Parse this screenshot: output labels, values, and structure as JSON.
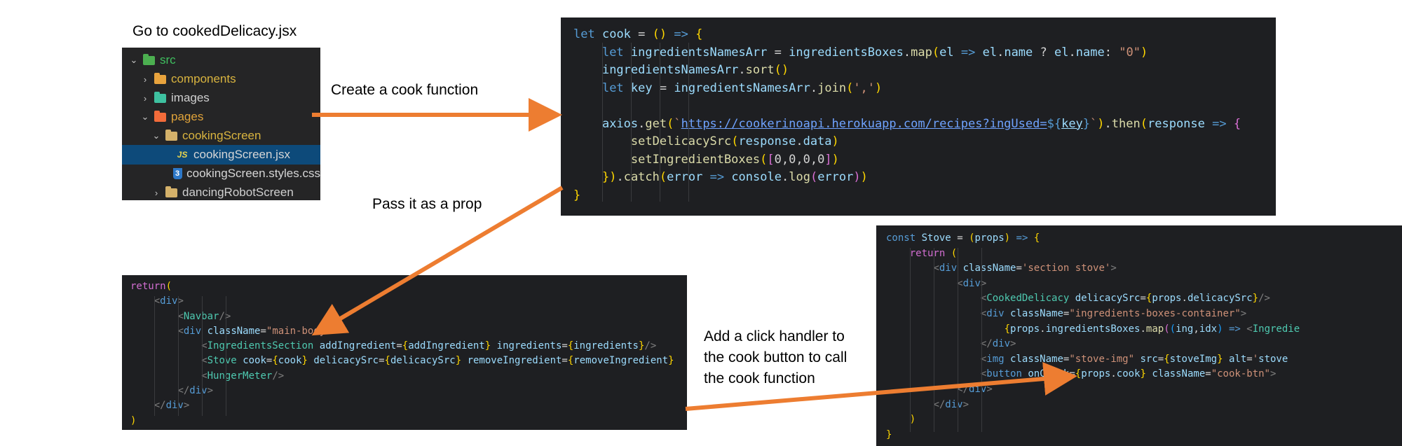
{
  "captions": {
    "goto": "Go to cookedDelicacy.jsx",
    "create": "Create a cook function",
    "pass": "Pass it as a prop",
    "click_1": "Add a click handler to",
    "click_2": "the cook button to call",
    "click_3": "the cook function"
  },
  "explorer": {
    "items": [
      {
        "label": "src",
        "icon": "src-folder-icon",
        "expanded": true
      },
      {
        "label": "components",
        "icon": "components-folder-icon",
        "expanded": false
      },
      {
        "label": "images",
        "icon": "images-folder-icon",
        "expanded": false
      },
      {
        "label": "pages",
        "icon": "pages-folder-icon",
        "expanded": true
      },
      {
        "label": "cookingScreen",
        "icon": "folder-open-icon",
        "expanded": true
      },
      {
        "label": "cookingScreen.jsx",
        "icon": "jsx-file-icon",
        "badge": "JS"
      },
      {
        "label": "cookingScreen.styles.css",
        "icon": "css-file-icon",
        "badge": "3"
      },
      {
        "label": "dancingRobotScreen",
        "icon": "folder-icon",
        "expanded": false
      }
    ]
  },
  "code": {
    "cook": [
      "let cook = () => {",
      "    let ingredientsNamesArr = ingredientsBoxes.map(el => el.name ? el.name: \"0\")",
      "    ingredientsNamesArr.sort()",
      "    let key = ingredientsNamesArr.join(',')",
      "",
      "    axios.get(`https://cookerinoapi.herokuapp.com/recipes?ingUsed=${key}`).then(response => {",
      "        setDelicacySrc(response.data)",
      "        setIngredientBoxes([0,0,0,0])",
      "    }).catch(error => console.log(error))",
      "}"
    ],
    "main": [
      "return(",
      "    <div>",
      "        <Navbar/>",
      "        <div className=\"main-body\">",
      "            <IngredientsSection addIngredient={addIngredient} ingredients={ingredients}/>",
      "            <Stove cook={cook} delicacySrc={delicacySrc} removeIngredient={removeIngredient}",
      "            <HungerMeter/>",
      "        </div>",
      "    </div>",
      ")"
    ],
    "stove": [
      "const Stove = (props) => {",
      "    return (",
      "        <div className='section stove'>",
      "            <div>",
      "                <CookedDelicacy delicacySrc={props.delicacySrc}/>",
      "                <div className=\"ingredients-boxes-container\">",
      "                    {props.ingredientsBoxes.map((ing,idx) => <Ingredie",
      "                </div>",
      "                <img className=\"stove-img\" src={stoveImg} alt='stove",
      "                <button onClick={props.cook} className=\"cook-btn\">",
      "            </div>",
      "        </div>",
      "    )",
      "}"
    ]
  },
  "colors": {
    "arrow": "#ed7d31",
    "panel_bg": "#1e1f22",
    "explorer_bg": "#252526",
    "selection": "#0d4a7a"
  }
}
